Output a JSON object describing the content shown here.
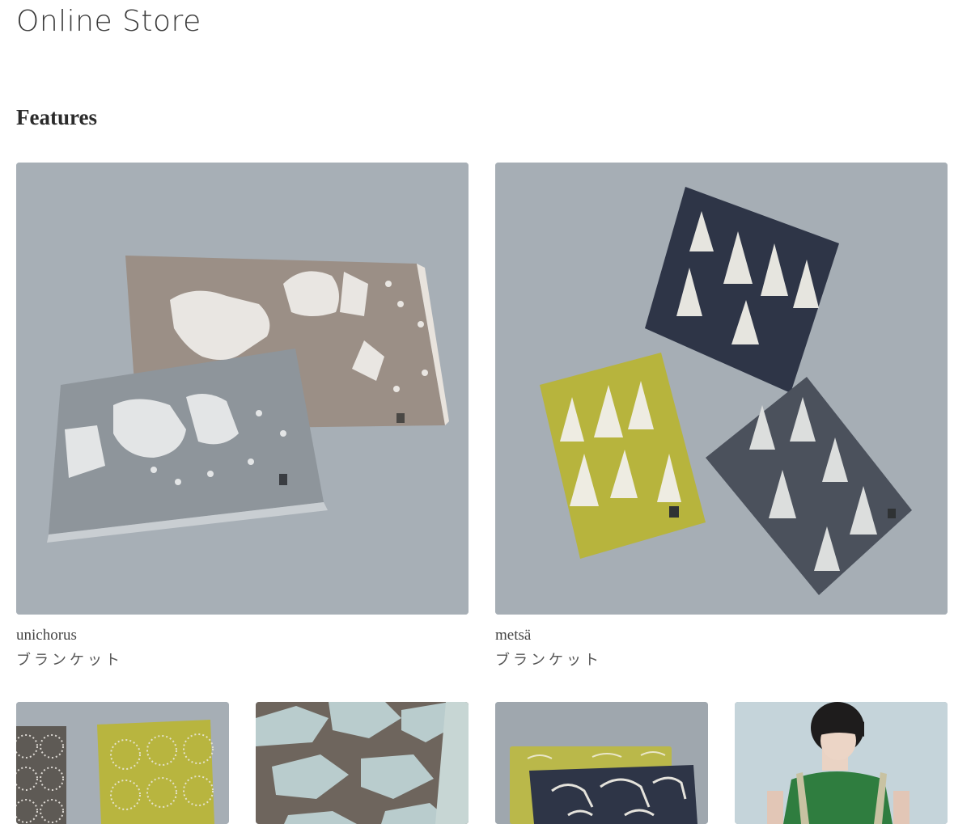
{
  "header": {
    "title": "Online Store"
  },
  "features": {
    "heading": "Features",
    "items": [
      {
        "name": "unichorus",
        "category": "ブランケット",
        "image_icon": "unicorn-blanket-image"
      },
      {
        "name": "metsä",
        "category": "ブランケット",
        "image_icon": "forest-blanket-image"
      }
    ]
  },
  "thumbnails": [
    {
      "image_icon": "circle-pattern-blanket-image"
    },
    {
      "image_icon": "bird-silhouette-blanket-image"
    },
    {
      "image_icon": "bird-illustration-blanket-image"
    },
    {
      "image_icon": "model-with-green-top-image"
    }
  ],
  "colors": {
    "backdrop": "#a9b1b8",
    "taupe_blanket": "#9d9189",
    "grey_blanket": "#8f969c",
    "navy_blanket": "#2e3648",
    "yellow_blanket": "#b9b63c",
    "green_top": "#2f7d3f"
  }
}
